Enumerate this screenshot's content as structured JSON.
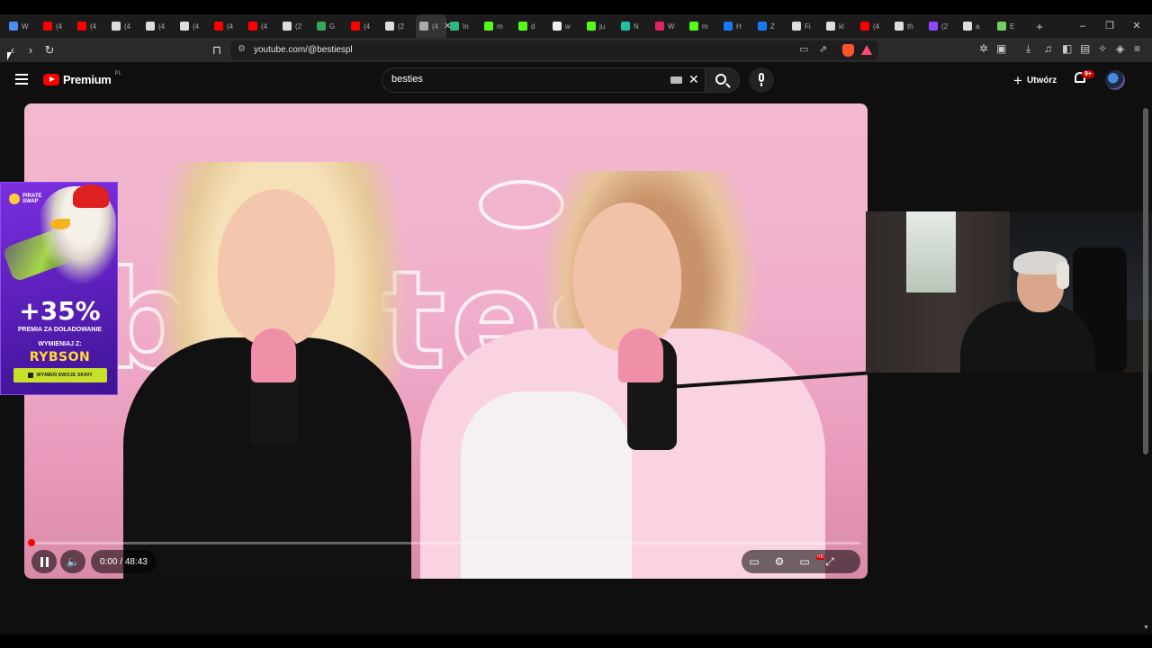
{
  "browser": {
    "tabs": [
      {
        "label": "W",
        "color": "#4e8cf5"
      },
      {
        "label": "(4",
        "color": "#ff0000"
      },
      {
        "label": "(4",
        "color": "#ff0000"
      },
      {
        "label": "(4",
        "color": "#dddddd"
      },
      {
        "label": "(4",
        "color": "#dddddd"
      },
      {
        "label": "(4",
        "color": "#dddddd"
      },
      {
        "label": "(4",
        "color": "#ff0000"
      },
      {
        "label": "(4",
        "color": "#ff0000"
      },
      {
        "label": "(2",
        "color": "#dddddd"
      },
      {
        "label": "G",
        "color": "#34a853"
      },
      {
        "label": "(4",
        "color": "#ff0000"
      },
      {
        "label": "(2",
        "color": "#dddddd"
      },
      {
        "label": "(4",
        "color": "#aaaaaa",
        "active": true
      },
      {
        "label": "In",
        "color": "#2db87d"
      },
      {
        "label": "m",
        "color": "#53fc18"
      },
      {
        "label": "d",
        "color": "#53fc18"
      },
      {
        "label": "w",
        "color": "#eeeeee"
      },
      {
        "label": "ju",
        "color": "#53fc18"
      },
      {
        "label": "N",
        "color": "#20c0a0"
      },
      {
        "label": "W",
        "color": "#e0245e"
      },
      {
        "label": "m",
        "color": "#53fc18"
      },
      {
        "label": "H",
        "color": "#1877f2"
      },
      {
        "label": "Z",
        "color": "#1877f2"
      },
      {
        "label": "Fi",
        "color": "#dddddd"
      },
      {
        "label": "kl",
        "color": "#dddddd"
      },
      {
        "label": "(4",
        "color": "#ff0000"
      },
      {
        "label": "th",
        "color": "#dddddd"
      },
      {
        "label": "(2",
        "color": "#9146ff"
      },
      {
        "label": "a",
        "color": "#dddddd"
      },
      {
        "label": "E",
        "color": "#6fcf5c"
      }
    ],
    "new_tab_glyph": "+",
    "tab_close_glyph": "✕",
    "window_controls": {
      "minimize": "–",
      "restore": "❐",
      "close": "✕"
    },
    "nav": {
      "back": "‹",
      "forward": "›",
      "reload": "↻",
      "bookmark": "⊓"
    },
    "url": "youtube.com/@bestiespl"
  },
  "youtube": {
    "logo_text": "Premium",
    "country_code": "PL",
    "search_value": "besties",
    "create_label": "Utwórz",
    "notification_count": "9+"
  },
  "player": {
    "time_current": "0:00",
    "time_separator": "/",
    "time_total": "48:43",
    "progress": 0.0
  },
  "ad": {
    "brand_line1": "PIRATE",
    "brand_line2": "SWAP",
    "percent": "+35%",
    "line1": "PREMIA ZA DOŁADOWANIE",
    "line2": "WYMIENIAJ Z:",
    "code": "RYBSON",
    "cta": "WYMIEŃ SWOJE SKINY"
  },
  "neon_sign": "bestes",
  "colors": {
    "youtube_red": "#ff0000",
    "ad_purple": "#6a25cc",
    "ad_code_yellow": "#ffd83a",
    "ad_cta_green": "#c7e02b",
    "video_pink": "#efaecb"
  }
}
